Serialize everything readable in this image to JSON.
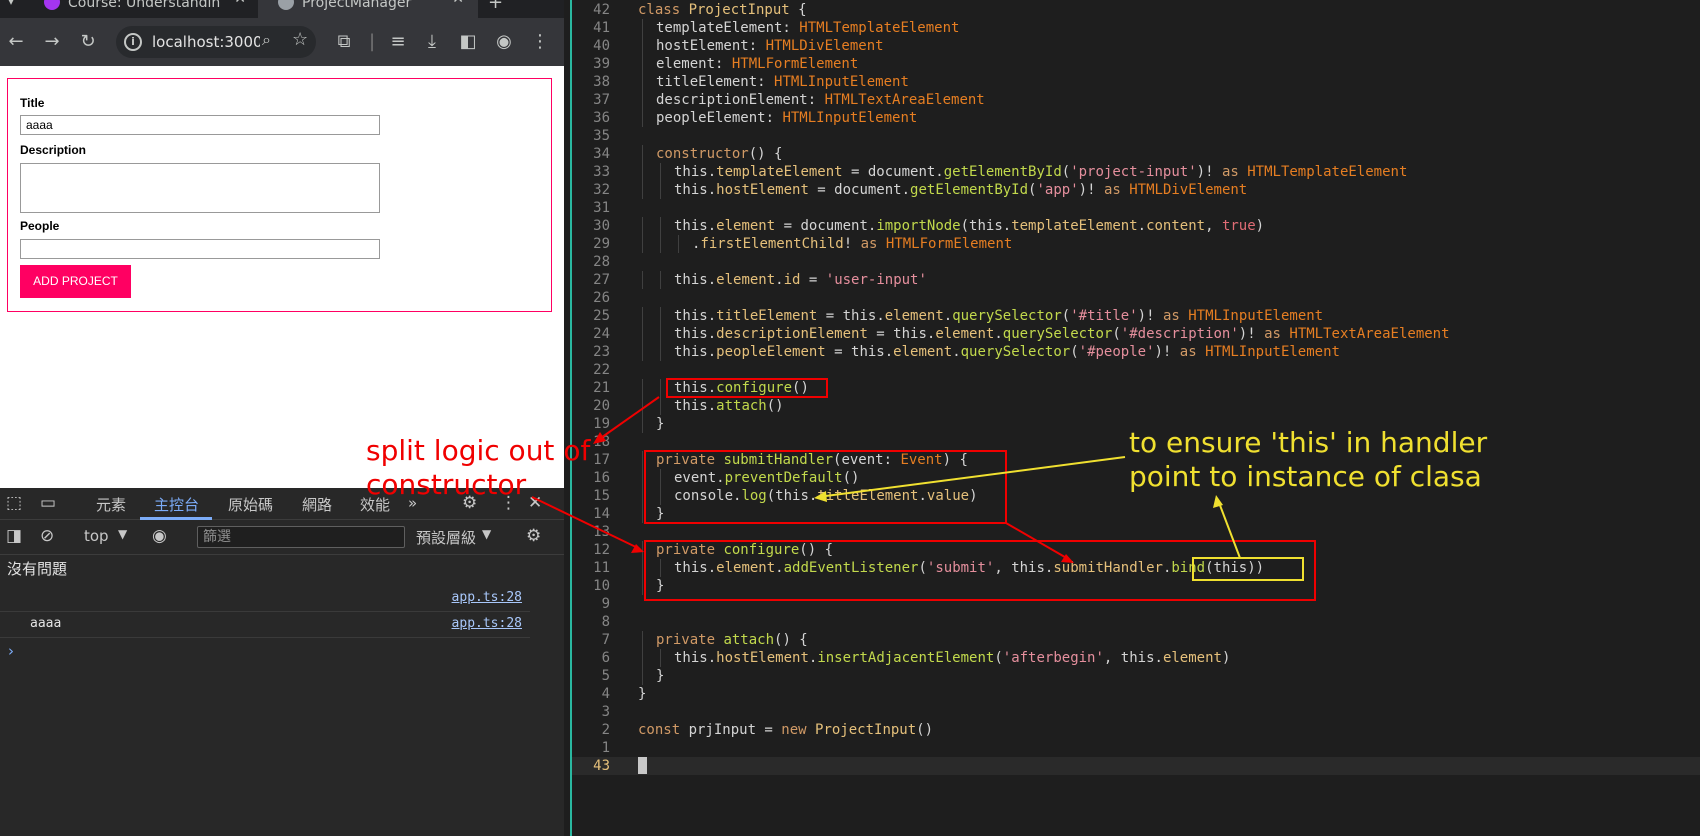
{
  "browser": {
    "tabs": [
      {
        "label": "Course: Understandin"
      },
      {
        "label": "ProjectManager"
      }
    ],
    "close_glyph": "✕",
    "newtab_glyph": "+",
    "url": "localhost:3000",
    "form": {
      "title_label": "Title",
      "title_value": "aaaa",
      "description_label": "Description",
      "people_label": "People",
      "submit_label": "ADD PROJECT"
    }
  },
  "devtools": {
    "tabs": [
      "元素",
      "主控台",
      "原始碼",
      "網路",
      "效能"
    ],
    "more": "»",
    "context": "top",
    "filter_placeholder": "篩選",
    "levels": "預設層級",
    "no_issues": "沒有問題",
    "logs": [
      {
        "message": "",
        "source": "app.ts:28"
      },
      {
        "message": "aaaa",
        "source": "app.ts:28"
      }
    ],
    "prompt": "›"
  },
  "editor": {
    "lines": [
      {
        "n": "42",
        "i": 0,
        "t": [
          [
            "kw",
            "class "
          ],
          [
            "cls",
            "ProjectInput"
          ],
          [
            "plain",
            " {"
          ]
        ]
      },
      {
        "n": "41",
        "i": 1,
        "t": [
          [
            "plain",
            "templateElement: "
          ],
          [
            "type",
            "HTMLTemplateElement"
          ]
        ]
      },
      {
        "n": "40",
        "i": 1,
        "t": [
          [
            "plain",
            "hostElement: "
          ],
          [
            "type",
            "HTMLDivElement"
          ]
        ]
      },
      {
        "n": "39",
        "i": 1,
        "t": [
          [
            "plain",
            "element: "
          ],
          [
            "type",
            "HTMLFormElement"
          ]
        ]
      },
      {
        "n": "38",
        "i": 1,
        "t": [
          [
            "plain",
            "titleElement: "
          ],
          [
            "type",
            "HTMLInputElement"
          ]
        ]
      },
      {
        "n": "37",
        "i": 1,
        "t": [
          [
            "plain",
            "descriptionElement: "
          ],
          [
            "type",
            "HTMLTextAreaElement"
          ]
        ]
      },
      {
        "n": "36",
        "i": 1,
        "t": [
          [
            "plain",
            "peopleElement: "
          ],
          [
            "type",
            "HTMLInputElement"
          ]
        ]
      },
      {
        "n": "35",
        "i": 0,
        "t": []
      },
      {
        "n": "34",
        "i": 1,
        "t": [
          [
            "kw",
            "constructor"
          ],
          [
            "plain",
            "() {"
          ]
        ]
      },
      {
        "n": "33",
        "i": 2,
        "t": [
          [
            "plain",
            "this."
          ],
          [
            "prop",
            "templateElement"
          ],
          [
            "plain",
            " = document."
          ],
          [
            "fn",
            "getElementById"
          ],
          [
            "plain",
            "("
          ],
          [
            "str",
            "'project-input'"
          ],
          [
            "plain",
            ")! "
          ],
          [
            "kw",
            "as "
          ],
          [
            "type",
            "HTMLTemplateElement"
          ]
        ]
      },
      {
        "n": "32",
        "i": 2,
        "t": [
          [
            "plain",
            "this."
          ],
          [
            "prop",
            "hostElement"
          ],
          [
            "plain",
            " = document."
          ],
          [
            "fn",
            "getElementById"
          ],
          [
            "plain",
            "("
          ],
          [
            "str",
            "'app'"
          ],
          [
            "plain",
            ")! "
          ],
          [
            "kw",
            "as "
          ],
          [
            "type",
            "HTMLDivElement"
          ]
        ]
      },
      {
        "n": "31",
        "i": 0,
        "t": []
      },
      {
        "n": "30",
        "i": 2,
        "t": [
          [
            "plain",
            "this."
          ],
          [
            "prop",
            "element"
          ],
          [
            "plain",
            " = document."
          ],
          [
            "fn",
            "importNode"
          ],
          [
            "plain",
            "(this."
          ],
          [
            "prop",
            "templateElement"
          ],
          [
            "plain",
            "."
          ],
          [
            "prop",
            "content"
          ],
          [
            "plain",
            ", "
          ],
          [
            "bool",
            "true"
          ],
          [
            "plain",
            ")"
          ]
        ]
      },
      {
        "n": "29",
        "i": 3,
        "t": [
          [
            "plain",
            "."
          ],
          [
            "prop",
            "firstElementChild"
          ],
          [
            "plain",
            "! "
          ],
          [
            "kw",
            "as "
          ],
          [
            "type",
            "HTMLFormElement"
          ]
        ]
      },
      {
        "n": "28",
        "i": 0,
        "t": []
      },
      {
        "n": "27",
        "i": 2,
        "t": [
          [
            "plain",
            "this."
          ],
          [
            "prop",
            "element"
          ],
          [
            "plain",
            "."
          ],
          [
            "prop",
            "id"
          ],
          [
            "plain",
            " = "
          ],
          [
            "str",
            "'user-input'"
          ]
        ]
      },
      {
        "n": "26",
        "i": 0,
        "t": []
      },
      {
        "n": "25",
        "i": 2,
        "t": [
          [
            "plain",
            "this."
          ],
          [
            "prop",
            "titleElement"
          ],
          [
            "plain",
            " = this."
          ],
          [
            "prop",
            "element"
          ],
          [
            "plain",
            "."
          ],
          [
            "fn",
            "querySelector"
          ],
          [
            "plain",
            "("
          ],
          [
            "str",
            "'#title'"
          ],
          [
            "plain",
            ")! "
          ],
          [
            "kw",
            "as "
          ],
          [
            "type",
            "HTMLInputElement"
          ]
        ]
      },
      {
        "n": "24",
        "i": 2,
        "t": [
          [
            "plain",
            "this."
          ],
          [
            "prop",
            "descriptionElement"
          ],
          [
            "plain",
            " = this."
          ],
          [
            "prop",
            "element"
          ],
          [
            "plain",
            "."
          ],
          [
            "fn",
            "querySelector"
          ],
          [
            "plain",
            "("
          ],
          [
            "str",
            "'#description'"
          ],
          [
            "plain",
            ")! "
          ],
          [
            "kw",
            "as "
          ],
          [
            "type",
            "HTMLTextAreaElement"
          ]
        ]
      },
      {
        "n": "23",
        "i": 2,
        "t": [
          [
            "plain",
            "this."
          ],
          [
            "prop",
            "peopleElement"
          ],
          [
            "plain",
            " = this."
          ],
          [
            "prop",
            "element"
          ],
          [
            "plain",
            "."
          ],
          [
            "fn",
            "querySelector"
          ],
          [
            "plain",
            "("
          ],
          [
            "str",
            "'#people'"
          ],
          [
            "plain",
            ")! "
          ],
          [
            "kw",
            "as "
          ],
          [
            "type",
            "HTMLInputElement"
          ]
        ]
      },
      {
        "n": "22",
        "i": 0,
        "t": []
      },
      {
        "n": "21",
        "i": 2,
        "t": [
          [
            "plain",
            "this."
          ],
          [
            "fn",
            "configure"
          ],
          [
            "plain",
            "()"
          ]
        ]
      },
      {
        "n": "20",
        "i": 2,
        "t": [
          [
            "plain",
            "this."
          ],
          [
            "fn",
            "attach"
          ],
          [
            "plain",
            "()"
          ]
        ]
      },
      {
        "n": "19",
        "i": 1,
        "t": [
          [
            "plain",
            "}"
          ]
        ]
      },
      {
        "n": "18",
        "i": 0,
        "t": []
      },
      {
        "n": "17",
        "i": 1,
        "t": [
          [
            "kw",
            "private "
          ],
          [
            "fn",
            "submitHandler"
          ],
          [
            "plain",
            "(event: "
          ],
          [
            "type",
            "Event"
          ],
          [
            "plain",
            ") {"
          ]
        ]
      },
      {
        "n": "16",
        "i": 2,
        "t": [
          [
            "plain",
            "event."
          ],
          [
            "fn",
            "preventDefault"
          ],
          [
            "plain",
            "()"
          ]
        ]
      },
      {
        "n": "15",
        "i": 2,
        "t": [
          [
            "plain",
            "console."
          ],
          [
            "fn",
            "log"
          ],
          [
            "plain",
            "(this."
          ],
          [
            "prop",
            "titleElement"
          ],
          [
            "plain",
            "."
          ],
          [
            "prop",
            "value"
          ],
          [
            "plain",
            ")"
          ]
        ]
      },
      {
        "n": "14",
        "i": 1,
        "t": [
          [
            "plain",
            "}"
          ]
        ]
      },
      {
        "n": "13",
        "i": 0,
        "t": []
      },
      {
        "n": "12",
        "i": 1,
        "t": [
          [
            "kw",
            "private "
          ],
          [
            "fn",
            "configure"
          ],
          [
            "plain",
            "() {"
          ]
        ]
      },
      {
        "n": "11",
        "i": 2,
        "t": [
          [
            "plain",
            "this."
          ],
          [
            "prop",
            "element"
          ],
          [
            "plain",
            "."
          ],
          [
            "fn",
            "addEventListener"
          ],
          [
            "plain",
            "("
          ],
          [
            "str",
            "'submit'"
          ],
          [
            "plain",
            ", this."
          ],
          [
            "prop",
            "submitHandler"
          ],
          [
            "plain",
            "."
          ],
          [
            "fn",
            "bind"
          ],
          [
            "plain",
            "(this))"
          ]
        ]
      },
      {
        "n": "10",
        "i": 1,
        "t": [
          [
            "plain",
            "}"
          ]
        ]
      },
      {
        "n": "9",
        "i": 0,
        "t": []
      },
      {
        "n": "8",
        "i": 0,
        "t": []
      },
      {
        "n": "7",
        "i": 1,
        "t": [
          [
            "kw",
            "private "
          ],
          [
            "fn",
            "attach"
          ],
          [
            "plain",
            "() {"
          ]
        ]
      },
      {
        "n": "6",
        "i": 2,
        "t": [
          [
            "plain",
            "this."
          ],
          [
            "prop",
            "hostElement"
          ],
          [
            "plain",
            "."
          ],
          [
            "fn",
            "insertAdjacentElement"
          ],
          [
            "plain",
            "("
          ],
          [
            "str",
            "'afterbegin'"
          ],
          [
            "plain",
            ", this."
          ],
          [
            "prop",
            "element"
          ],
          [
            "plain",
            ")"
          ]
        ]
      },
      {
        "n": "5",
        "i": 1,
        "t": [
          [
            "plain",
            "}"
          ]
        ]
      },
      {
        "n": "4",
        "i": 0,
        "t": [
          [
            "plain",
            "}"
          ]
        ]
      },
      {
        "n": "3",
        "i": 0,
        "t": []
      },
      {
        "n": "2",
        "i": 0,
        "t": [
          [
            "kw",
            "const "
          ],
          [
            "plain",
            "prjInput = "
          ],
          [
            "kw",
            "new "
          ],
          [
            "cls",
            "ProjectInput"
          ],
          [
            "plain",
            "()"
          ]
        ]
      },
      {
        "n": "1",
        "i": 0,
        "t": []
      },
      {
        "n": "43",
        "i": 0,
        "t": [],
        "current": true
      }
    ]
  },
  "annotations": {
    "red_note": "split logic out of\nconstructor",
    "yellow_note": "to ensure 'this' in handler\npoint to instance of clasa"
  },
  "colors": {
    "accent_pink": "#ff0062",
    "annotation_red": "#f00000",
    "annotation_yellow": "#f0e030",
    "divider_teal": "#2ab8a0"
  }
}
